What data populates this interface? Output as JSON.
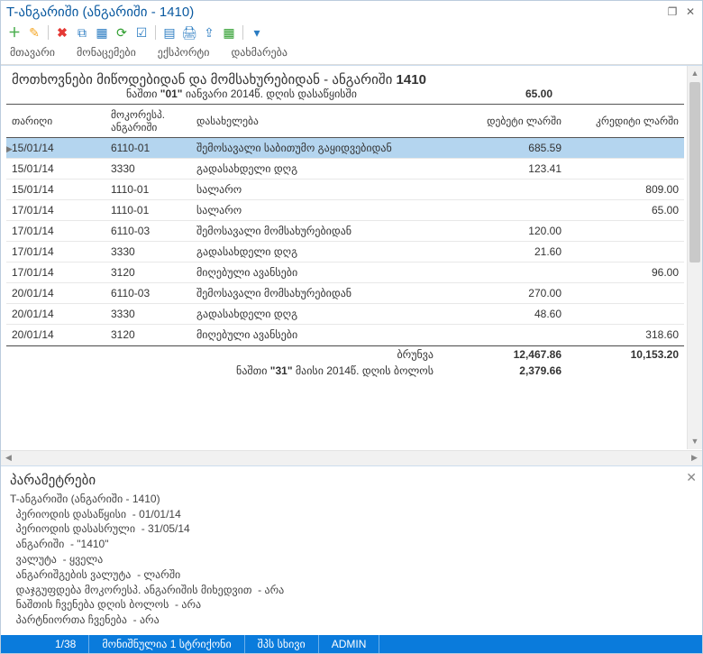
{
  "window": {
    "title": "T-ანგარიში (ანგარიში - 1410)"
  },
  "menu": {
    "main": "მთავარი",
    "data": "მონაცემები",
    "export": "ექსპორტი",
    "help": "დახმარება"
  },
  "report": {
    "title_prefix": "მოთხოვნები მიწოდებიდან და მომსახურებიდან - ანგარიში ",
    "title_account": "1410",
    "opening_label_pre": "ნაშთი ",
    "opening_date_strong": "\"01\"",
    "opening_label_post": " იანვარი 2014წ. დღის დასაწყისში",
    "opening_value": "65.00",
    "columns": {
      "date": "თარიღი",
      "account": "მოკორესპ. ანგარიში",
      "desc": "დასახელება",
      "debit": "დებეტი ლარში",
      "credit": "კრედიტი ლარში"
    },
    "rows": [
      {
        "date": "15/01/14",
        "acc": "6110-01",
        "desc": "შემოსავალი საბითუმო გაყიდვებიდან",
        "debit": "685.59",
        "credit": "",
        "selected": true
      },
      {
        "date": "15/01/14",
        "acc": "3330",
        "desc": "გადასახდელი დღგ",
        "debit": "123.41",
        "credit": ""
      },
      {
        "date": "15/01/14",
        "acc": "1110-01",
        "desc": "სალარო",
        "debit": "",
        "credit": "809.00"
      },
      {
        "date": "17/01/14",
        "acc": "1110-01",
        "desc": "სალარო",
        "debit": "",
        "credit": "65.00"
      },
      {
        "date": "17/01/14",
        "acc": "6110-03",
        "desc": "შემოსავალი მომსახურებიდან",
        "debit": "120.00",
        "credit": ""
      },
      {
        "date": "17/01/14",
        "acc": "3330",
        "desc": "გადასახდელი დღგ",
        "debit": "21.60",
        "credit": ""
      },
      {
        "date": "17/01/14",
        "acc": "3120",
        "desc": "მიღებული ავანსები",
        "debit": "",
        "credit": "96.00"
      },
      {
        "date": "20/01/14",
        "acc": "6110-03",
        "desc": "შემოსავალი მომსახურებიდან",
        "debit": "270.00",
        "credit": ""
      },
      {
        "date": "20/01/14",
        "acc": "3330",
        "desc": "გადასახდელი დღგ",
        "debit": "48.60",
        "credit": ""
      },
      {
        "date": "20/01/14",
        "acc": "3120",
        "desc": "მიღებული ავანსები",
        "debit": "",
        "credit": "318.60"
      }
    ],
    "turnover_label": "ბრუნვა",
    "turnover_debit": "12,467.86",
    "turnover_credit": "10,153.20",
    "closing_label_pre": "ნაშთი ",
    "closing_date_strong": "\"31\"",
    "closing_label_post": " მაისი 2014წ. დღის ბოლოს",
    "closing_value": "2,379.66"
  },
  "params": {
    "heading": "პარამეტრები",
    "lines": [
      "T-ანგარიში (ანგარიში - 1410)",
      "  პერიოდის დასაწყისი  - 01/01/14",
      "  პერიოდის დასასრული  - 31/05/14",
      "  ანგარიში  - \"1410\"",
      "  ვალუტა  - ყველა",
      "  ანგარიშგების ვალუტა  - ლარში",
      "  დაჯგუფდება მოკორესპ. ანგარიშის მიხედვით  - არა",
      "  ნაშთის ჩვენება დღის ბოლოს  - არა",
      "  პარტნიორთა ჩვენება  - არა"
    ]
  },
  "status": {
    "position": "1/38",
    "selection": "მონიშნულია 1 სტრიქონი",
    "company": "შპს სხივი",
    "user": "ADMIN"
  }
}
